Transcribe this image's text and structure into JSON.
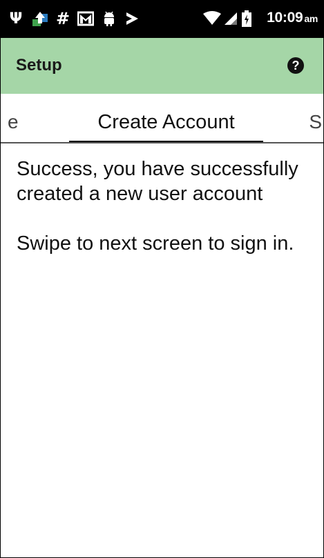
{
  "status_bar": {
    "icons": [
      "usb-icon",
      "upload-icon",
      "hash-icon",
      "gmail-icon",
      "android-icon",
      "play-store-icon",
      "wifi-icon",
      "signal-icon",
      "battery-icon"
    ],
    "time": "10:09",
    "ampm": "am"
  },
  "app_bar": {
    "title": "Setup",
    "help_icon": "?"
  },
  "tabs": {
    "prev_partial": "e",
    "active": "Create Account",
    "next_partial": "S"
  },
  "content": {
    "line1": "Success, you have successfully created a new user account",
    "line2": "Swipe to next screen to sign in."
  },
  "colors": {
    "status_bar": "#000000",
    "app_bar": "#a5d6a7",
    "tab_indicator": "#111111"
  }
}
